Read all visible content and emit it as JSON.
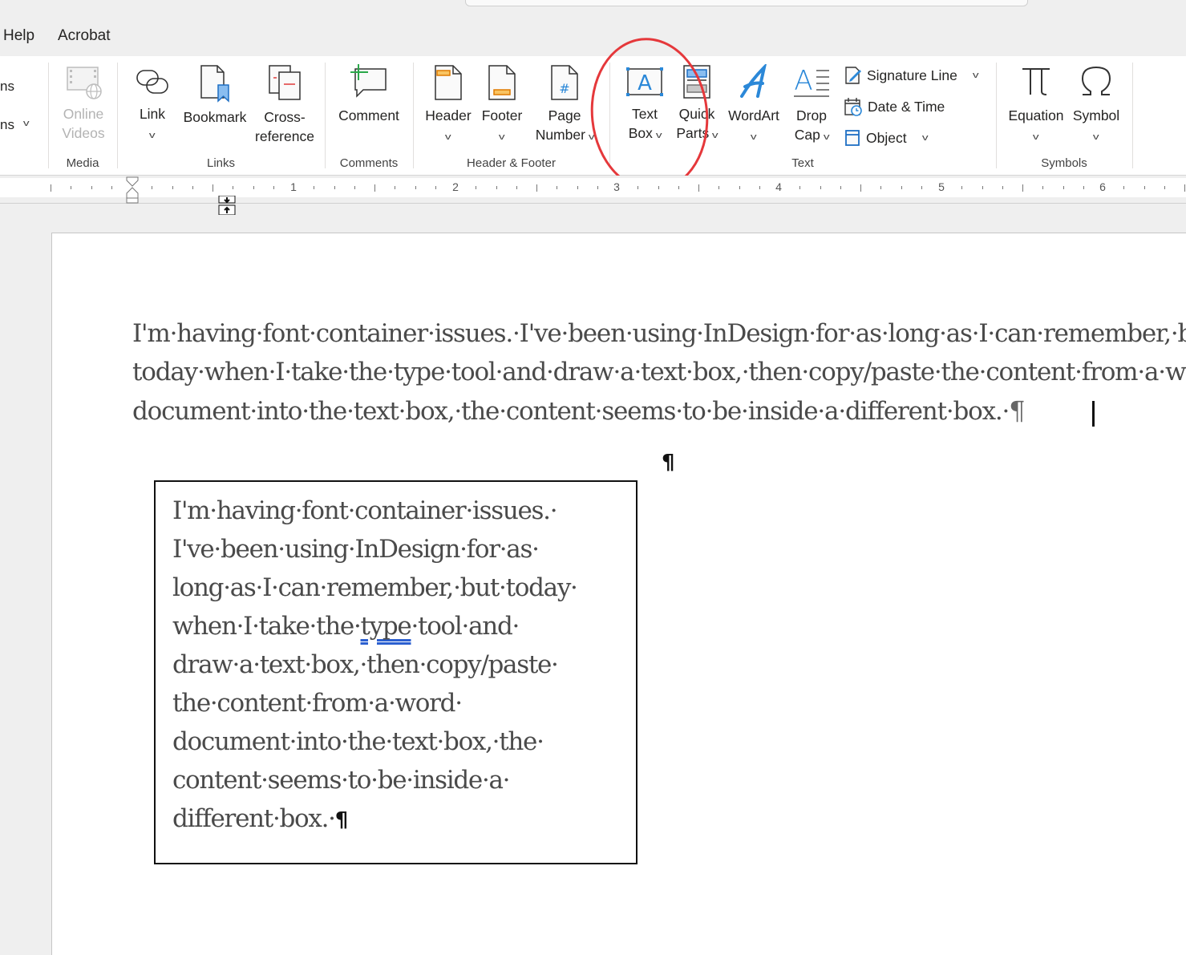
{
  "menu": {
    "tabs": [
      "Help",
      "Acrobat"
    ]
  },
  "ribbon": {
    "left_partial": [
      "ns",
      "ns"
    ],
    "groups": [
      {
        "name": "Media",
        "buttons": [
          {
            "label_line1": "Online",
            "label_line2": "Videos",
            "disabled": true
          }
        ]
      },
      {
        "name": "Links",
        "buttons": [
          {
            "label_line1": "Link",
            "label_line2": "",
            "dropdown": true
          },
          {
            "label_line1": "Bookmark",
            "label_line2": ""
          },
          {
            "label_line1": "Cross-",
            "label_line2": "reference"
          }
        ]
      },
      {
        "name": "Comments",
        "buttons": [
          {
            "label_line1": "Comment",
            "label_line2": ""
          }
        ]
      },
      {
        "name": "Header & Footer",
        "buttons": [
          {
            "label_line1": "Header",
            "dropdown": true
          },
          {
            "label_line1": "Footer",
            "dropdown": true
          },
          {
            "label_line1": "Page",
            "label_line2": "Number",
            "dropdown": true
          }
        ]
      },
      {
        "name": "Text",
        "buttons": [
          {
            "label_line1": "Text",
            "label_line2": "Box",
            "dropdown": true
          },
          {
            "label_line1": "Quick",
            "label_line2": "Parts",
            "dropdown": true
          },
          {
            "label_line1": "WordArt",
            "dropdown": true
          },
          {
            "label_line1": "Drop",
            "label_line2": "Cap",
            "dropdown": true
          }
        ],
        "small_buttons": [
          {
            "label": "Signature Line",
            "dropdown": true
          },
          {
            "label": "Date & Time",
            "dropdown": false
          },
          {
            "label": "Object",
            "dropdown": true
          }
        ]
      },
      {
        "name": "Symbols",
        "buttons": [
          {
            "label_line1": "Equation",
            "dropdown": true
          },
          {
            "label_line1": "Symbol",
            "dropdown": true
          }
        ]
      }
    ]
  },
  "ruler": {
    "numbers": [
      "1",
      "2",
      "3",
      "4",
      "5",
      "6"
    ]
  },
  "document": {
    "paragraph_lines": [
      "I'm·having·font·container·issues.·I've·been·using·InDesign·for·as·long·as·I·can·remember,·but",
      "today·when·I·take·the·type·tool·and·draw·a·text·box,·then·copy/paste·the·content·from·a·word·",
      "document·into·the·text·box,·the·content·seems·to·be·inside·a·different·box.·"
    ],
    "pilcrow": "¶",
    "empty_paragraph_mark": "¶",
    "textbox_lines": [
      "I'm·having·font·container·issues.·",
      "I've·been·using·InDesign·for·as·",
      "long·as·I·can·remember,·but·today·",
      "when·I·take·the·",
      "draw·a·text·box,·then·copy/paste·",
      "the·content·from·a·word·",
      "document·into·the·text·box,·the·",
      "content·seems·to·be·inside·a·",
      "different·box.·"
    ],
    "textbox_flagged_word": "type",
    "textbox_line4_rest": "·tool·and·"
  },
  "colors": {
    "annotation_circle": "#e5383b",
    "icon_blue": "#2b88d8",
    "spellcheck_underline": "#2b5fd0"
  }
}
